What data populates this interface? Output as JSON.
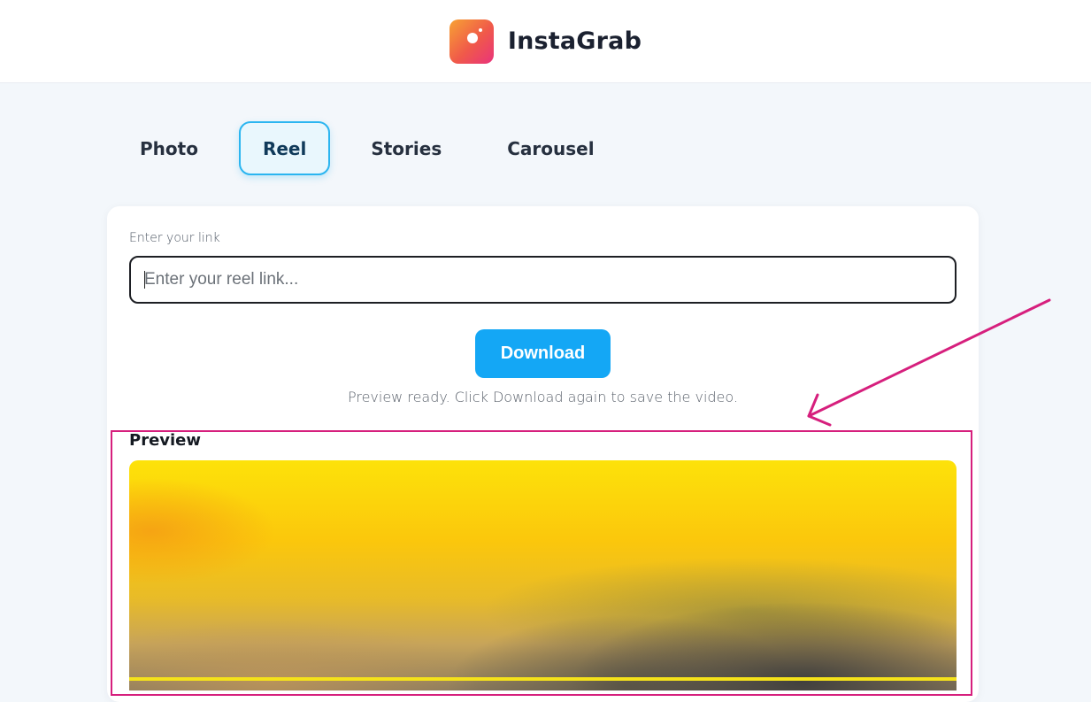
{
  "header": {
    "app_name": "InstaGrab",
    "logo_icon": "camera-icon",
    "colors": {
      "logo_gradient": [
        "#f7a233",
        "#f0594a",
        "#e9337c"
      ]
    }
  },
  "tabs": [
    {
      "label": "Photo",
      "active": false
    },
    {
      "label": "Reel",
      "active": true
    },
    {
      "label": "Stories",
      "active": false
    },
    {
      "label": "Carousel",
      "active": false
    }
  ],
  "form": {
    "label": "Enter your link",
    "input_value": "",
    "input_placeholder": "Enter your reel link...",
    "download_label": "Download",
    "status": "Preview ready. Click Download again to save the video."
  },
  "preview": {
    "title": "Preview"
  },
  "colors": {
    "accent": "#14a7f5",
    "active_tab_border": "#2bb5f0",
    "annotation": "#d61f7d",
    "background": "#f3f7fb"
  }
}
